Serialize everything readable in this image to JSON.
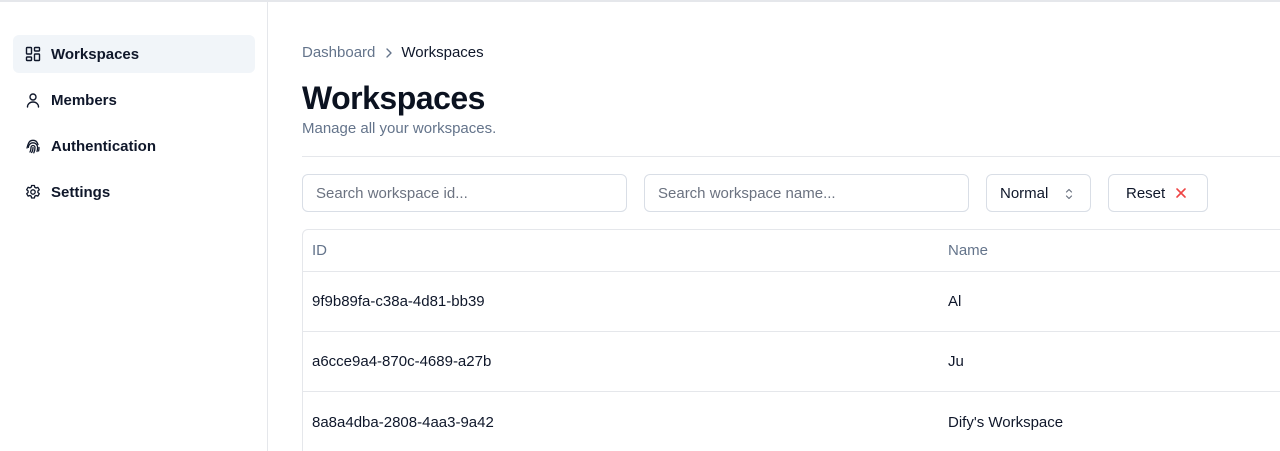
{
  "sidebar": {
    "items": [
      {
        "label": "Workspaces",
        "icon": "dashboard-icon",
        "active": true
      },
      {
        "label": "Members",
        "icon": "user-icon",
        "active": false
      },
      {
        "label": "Authentication",
        "icon": "fingerprint-icon",
        "active": false
      },
      {
        "label": "Settings",
        "icon": "gear-icon",
        "active": false
      }
    ]
  },
  "breadcrumb": {
    "parent": "Dashboard",
    "current": "Workspaces"
  },
  "page": {
    "title": "Workspaces",
    "subtitle": "Manage all your workspaces."
  },
  "filters": {
    "id_placeholder": "Search workspace id...",
    "id_value": "",
    "name_placeholder": "Search workspace name...",
    "name_value": "",
    "status_selected": "Normal",
    "reset_label": "Reset"
  },
  "table": {
    "columns": [
      "ID",
      "Name"
    ],
    "rows": [
      {
        "id": "9f9b89fa-c38a-4d81-bb39",
        "name": "Al"
      },
      {
        "id": "a6cce9a4-870c-4689-a27b",
        "name": "Ju"
      },
      {
        "id": "8a8a4dba-2808-4aa3-9a42",
        "name": "Dify's Workspace"
      }
    ]
  },
  "colors": {
    "accent_text": "#0f172a",
    "muted_text": "#64748b",
    "border": "#e5e7eb",
    "active_nav_bg": "#f1f5f9",
    "reset_icon": "#ef4444"
  }
}
